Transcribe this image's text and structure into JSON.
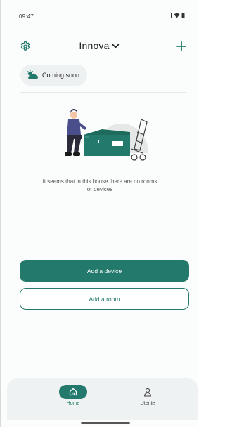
{
  "status_bar": {
    "time": "09:47",
    "icons": [
      "vibrate-icon",
      "wifi-icon",
      "battery-icon"
    ]
  },
  "header": {
    "home_name": "Innova",
    "settings_icon": "gear-icon",
    "add_icon": "plus-icon",
    "selector_icon": "chevron-down-icon"
  },
  "weather": {
    "icon": "partly-cloudy-icon",
    "label": "Coming soon"
  },
  "empty_state": {
    "message": "It seems that in this house there are no rooms or devices"
  },
  "actions": {
    "add_device": "Add a device",
    "add_room": "Add a room"
  },
  "bottom_nav": {
    "items": [
      {
        "label": "Home",
        "icon": "house-icon",
        "active": true
      },
      {
        "label": "Utente",
        "icon": "person-icon",
        "active": false
      }
    ]
  },
  "colors": {
    "accent": "#237a6c",
    "chip_bg": "#eef1f1",
    "nav_bg": "#eef2f2",
    "text": "#1e1e1e"
  }
}
